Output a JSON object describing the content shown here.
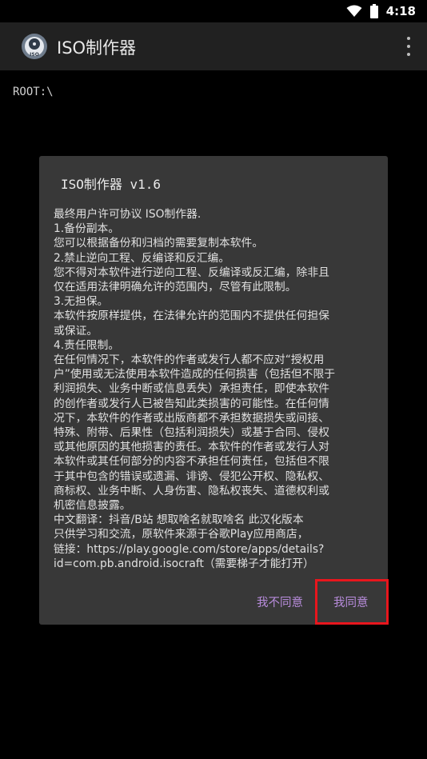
{
  "status_bar": {
    "time": "4:18",
    "icons": [
      "wifi-icon",
      "battery-icon"
    ]
  },
  "app_bar": {
    "logo_text": "ISO",
    "title": "ISO制作器",
    "menu_icon": "overflow-menu-icon"
  },
  "path": "ROOT:\\",
  "dialog": {
    "title": "ISO制作器 v1.6",
    "body_lines": [
      "最终用户许可协议 ISO制作器.",
      "1.备份副本。",
      "您可以根据备份和归档的需要复制本软件。",
      "2.禁止逆向工程、反编译和反汇编。",
      "您不得对本软件进行逆向工程、反编译或反汇编，除非且",
      "仅在适用法律明确允许的范围内，尽管有此限制。",
      "3.无担保。",
      "本软件按原样提供，在法律允许的范围内不提供任何担保",
      "或保证。",
      "4.责任限制。",
      "在任何情况下，本软件的作者或发行人都不应对“授权用",
      "户”使用或无法使用本软件造成的任何损害（包括但不限于",
      "利润损失、业务中断或信息丢失）承担责任，即使本软件",
      "的创作者或发行人已被告知此类损害的可能性。在任何情",
      "况下，本软件的作者或出版商都不承担数据损失或间接、",
      "特殊、附带、后果性（包括利润损失）或基于合同、侵权",
      "或其他原因的其他损害的责任。本软件的作者或发行人对",
      "本软件或其任何部分的内容不承担任何责任，包括但不限",
      "于其中包含的错误或遗漏、诽谤、侵犯公开权、隐私权、",
      "商标权、业务中断、人身伤害、隐私权丧失、道德权利或",
      "机密信息披露。",
      "中文翻译：抖音/B站 想取啥名就取啥名 此汉化版本",
      "只供学习和交流，原软件来源于谷歌Play应用商店，",
      "链接：https://play.google.com/store/apps/details?",
      "id=com.pb.android.isocraft（需要梯子才能打开）"
    ],
    "disagree_label": "我不同意",
    "agree_label": "我同意"
  },
  "colors": {
    "background": "#000000",
    "app_bar": "#212121",
    "dialog": "#383838",
    "button_text": "#b88cdc",
    "highlight": "#e8161d"
  }
}
